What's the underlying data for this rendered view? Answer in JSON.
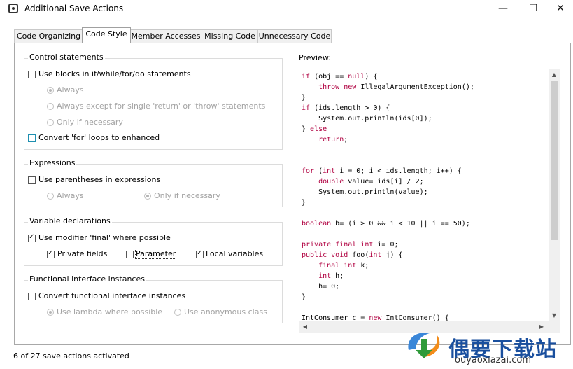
{
  "window": {
    "title": "Additional Save Actions",
    "minimize": "—",
    "maximize": "☐",
    "close": "✕"
  },
  "tabs": [
    {
      "label": "Code Organizing"
    },
    {
      "label": "Code Style"
    },
    {
      "label": "Member Accesses"
    },
    {
      "label": "Missing Code"
    },
    {
      "label": "Unnecessary Code"
    }
  ],
  "groups": {
    "control": {
      "title": "Control statements",
      "use_blocks": "Use blocks in if/while/for/do statements",
      "always": "Always",
      "always_except": "Always except for single 'return' or 'throw' statements",
      "only_if_necessary": "Only if necessary",
      "convert_for": "Convert 'for' loops to enhanced"
    },
    "expressions": {
      "title": "Expressions",
      "use_parentheses": "Use parentheses in expressions",
      "always": "Always",
      "only_if_necessary": "Only if necessary"
    },
    "variables": {
      "title": "Variable declarations",
      "use_final": "Use modifier 'final' where possible",
      "private_fields": "Private fields",
      "parameter": "Parameter",
      "local_variables": "Local variables"
    },
    "functional": {
      "title": "Functional interface instances",
      "convert": "Convert functional interface instances",
      "use_lambda": "Use lambda where possible",
      "use_anonymous": "Use anonymous class"
    }
  },
  "preview": {
    "label": "Preview:",
    "lines": [
      [
        {
          "t": "if",
          "k": true
        },
        {
          "t": " (obj == "
        },
        {
          "t": "null",
          "k": true
        },
        {
          "t": ") {"
        }
      ],
      [
        {
          "t": "    "
        },
        {
          "t": "throw",
          "k": true
        },
        {
          "t": " "
        },
        {
          "t": "new",
          "k": true
        },
        {
          "t": " IllegalArgumentException();"
        }
      ],
      [
        {
          "t": "}"
        }
      ],
      [
        {
          "t": "if",
          "k": true
        },
        {
          "t": " (ids.length > 0) {"
        }
      ],
      [
        {
          "t": "    System.out.println(ids[0]);"
        }
      ],
      [
        {
          "t": "} "
        },
        {
          "t": "else",
          "k": true
        }
      ],
      [
        {
          "t": "    "
        },
        {
          "t": "return",
          "k": true
        },
        {
          "t": ";"
        }
      ],
      [
        {
          "t": ""
        }
      ],
      [
        {
          "t": ""
        }
      ],
      [
        {
          "t": "for",
          "k": true
        },
        {
          "t": " ("
        },
        {
          "t": "int",
          "k": true
        },
        {
          "t": " i = 0; i < ids.length; i++) {"
        }
      ],
      [
        {
          "t": "    "
        },
        {
          "t": "double",
          "k": true
        },
        {
          "t": " value= ids[i] / 2;"
        }
      ],
      [
        {
          "t": "    System.out.println(value);"
        }
      ],
      [
        {
          "t": "}"
        }
      ],
      [
        {
          "t": ""
        }
      ],
      [
        {
          "t": "boolean",
          "k": true
        },
        {
          "t": " b= (i > 0 && i < 10 || i == 50);"
        }
      ],
      [
        {
          "t": ""
        }
      ],
      [
        {
          "t": "private",
          "k": true
        },
        {
          "t": " "
        },
        {
          "t": "final",
          "k": true
        },
        {
          "t": " "
        },
        {
          "t": "int",
          "k": true
        },
        {
          "t": " i= 0;"
        }
      ],
      [
        {
          "t": "public",
          "k": true
        },
        {
          "t": " "
        },
        {
          "t": "void",
          "k": true
        },
        {
          "t": " foo("
        },
        {
          "t": "int",
          "k": true
        },
        {
          "t": " j) {"
        }
      ],
      [
        {
          "t": "    "
        },
        {
          "t": "final",
          "k": true
        },
        {
          "t": " "
        },
        {
          "t": "int",
          "k": true
        },
        {
          "t": " k;"
        }
      ],
      [
        {
          "t": "    "
        },
        {
          "t": "int",
          "k": true
        },
        {
          "t": " h;"
        }
      ],
      [
        {
          "t": "    h= 0;"
        }
      ],
      [
        {
          "t": "}"
        }
      ],
      [
        {
          "t": ""
        }
      ],
      [
        {
          "t": "IntConsumer c = "
        },
        {
          "t": "new",
          "k": true
        },
        {
          "t": " IntConsumer() {"
        }
      ]
    ]
  },
  "status": "6 of 27 save actions activated",
  "watermark": {
    "brand": "偶要下载站",
    "url": "ouyaoxiazai.com"
  },
  "colors": {
    "keyword": "#b00040",
    "brand": "#1a4f9e"
  }
}
